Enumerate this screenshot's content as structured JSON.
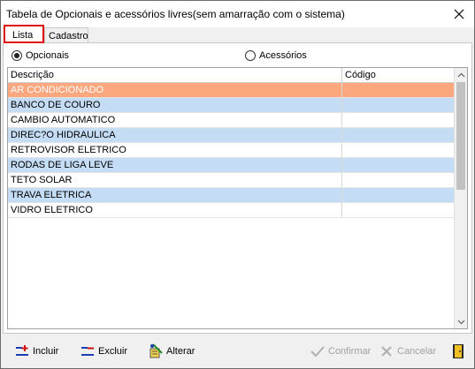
{
  "window": {
    "title": "Tabela de Opcionais e acessórios livres(sem amarração com o sistema)"
  },
  "tabs": [
    {
      "label": "Lista",
      "active": true
    },
    {
      "label": "Cadastro",
      "active": false
    }
  ],
  "filter": {
    "options": [
      {
        "label": "Opcionais",
        "checked": true
      },
      {
        "label": "Acessórios",
        "checked": false
      }
    ]
  },
  "grid": {
    "columns": [
      "Descrição",
      "Código"
    ],
    "rows": [
      {
        "descricao": "AR CONDICIONADO",
        "codigo": "",
        "state": "selected"
      },
      {
        "descricao": "BANCO DE COURO",
        "codigo": "",
        "state": "alt"
      },
      {
        "descricao": "CAMBIO AUTOMATICO",
        "codigo": "",
        "state": "normal"
      },
      {
        "descricao": "DIREC?O HIDRAULICA",
        "codigo": "",
        "state": "alt"
      },
      {
        "descricao": "RETROVISOR ELETRICO",
        "codigo": "",
        "state": "normal"
      },
      {
        "descricao": "RODAS DE LIGA LEVE",
        "codigo": "",
        "state": "alt"
      },
      {
        "descricao": "TETO SOLAR",
        "codigo": "",
        "state": "normal"
      },
      {
        "descricao": "TRAVA ELETRICA",
        "codigo": "",
        "state": "alt"
      },
      {
        "descricao": "VIDRO ELETRICO",
        "codigo": "",
        "state": "normal"
      }
    ]
  },
  "toolbar": {
    "incluir": "Incluir",
    "excluir": "Excluir",
    "alterar": "Alterar",
    "confirmar": "Confirmar",
    "cancelar": "Cancelar"
  },
  "colors": {
    "selected_row": "#fda77f",
    "alt_row": "#c5dcf5",
    "normal_row": "#ffffff",
    "active_tab_border": "#e01010"
  }
}
